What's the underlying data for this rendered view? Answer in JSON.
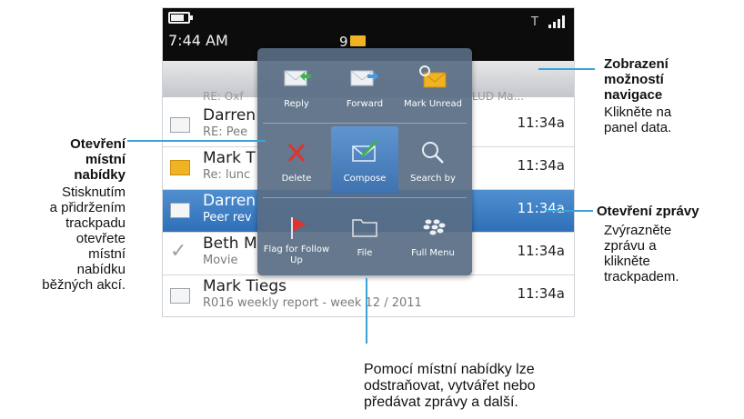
{
  "status": {
    "time": "7:44 AM",
    "unread_count": "9",
    "signal": "T"
  },
  "messages": [
    {
      "sender": "RE: Oxf",
      "subject": "",
      "time": "",
      "partial": true,
      "right_partial": "LUD Ma..."
    },
    {
      "sender": "Darren",
      "subject": "RE: Pee",
      "time": "11:34a",
      "icon": "envelope-read-icon"
    },
    {
      "sender": "Mark T",
      "subject": "Re: lunc",
      "time": "11:34a",
      "icon": "envelope-unread-icon"
    },
    {
      "sender": "Darren",
      "subject": "Peer rev",
      "time": "11:34a",
      "icon": "envelope-open-icon",
      "selected": true
    },
    {
      "sender": "Beth M",
      "subject": "Movie",
      "time": "11:34a",
      "icon": "checkmark-icon"
    },
    {
      "sender": "Mark Tiegs",
      "subject": "R016 weekly report - week 12 / 2011",
      "time": "11:34a",
      "icon": "envelope-read-icon"
    }
  ],
  "menu": [
    {
      "label": "Reply",
      "icon": "reply-icon"
    },
    {
      "label": "Forward",
      "icon": "forward-icon"
    },
    {
      "label": "Mark Unread",
      "icon": "mark-unread-icon"
    },
    {
      "label": "Delete",
      "icon": "delete-icon"
    },
    {
      "label": "Compose",
      "icon": "compose-icon",
      "selected": true
    },
    {
      "label": "Search by",
      "icon": "search-icon"
    },
    {
      "label": "Flag for\nFollow Up",
      "icon": "flag-icon"
    },
    {
      "label": "File",
      "icon": "folder-icon"
    },
    {
      "label": "Full Menu",
      "icon": "blackberry-icon"
    }
  ],
  "callouts": {
    "left_title": "Otevření\nmístní\nnabídky",
    "left_body": "Stisknutím\na přidržením\ntrackpadu\notevřete\nmístní\nnabídku\nběžných akcí.",
    "right1_title": "Zobrazení\nmožností\nnavigace",
    "right1_body": "Klikněte na\npanel data.",
    "right2_title": "Otevření zprávy",
    "right2_body": "Zvýrazněte\nzprávu a\nklikněte\ntrackpadem.",
    "bottom": "Pomocí místní nabídky lze\nodstraňovat, vytvářet nebo\npředávat zprávy a další."
  },
  "colors": {
    "accent": "#3ca1d6",
    "selection": "#3b79bf",
    "envelope": "#f0b323",
    "delete": "#e0332f",
    "flag": "#e0332f"
  }
}
